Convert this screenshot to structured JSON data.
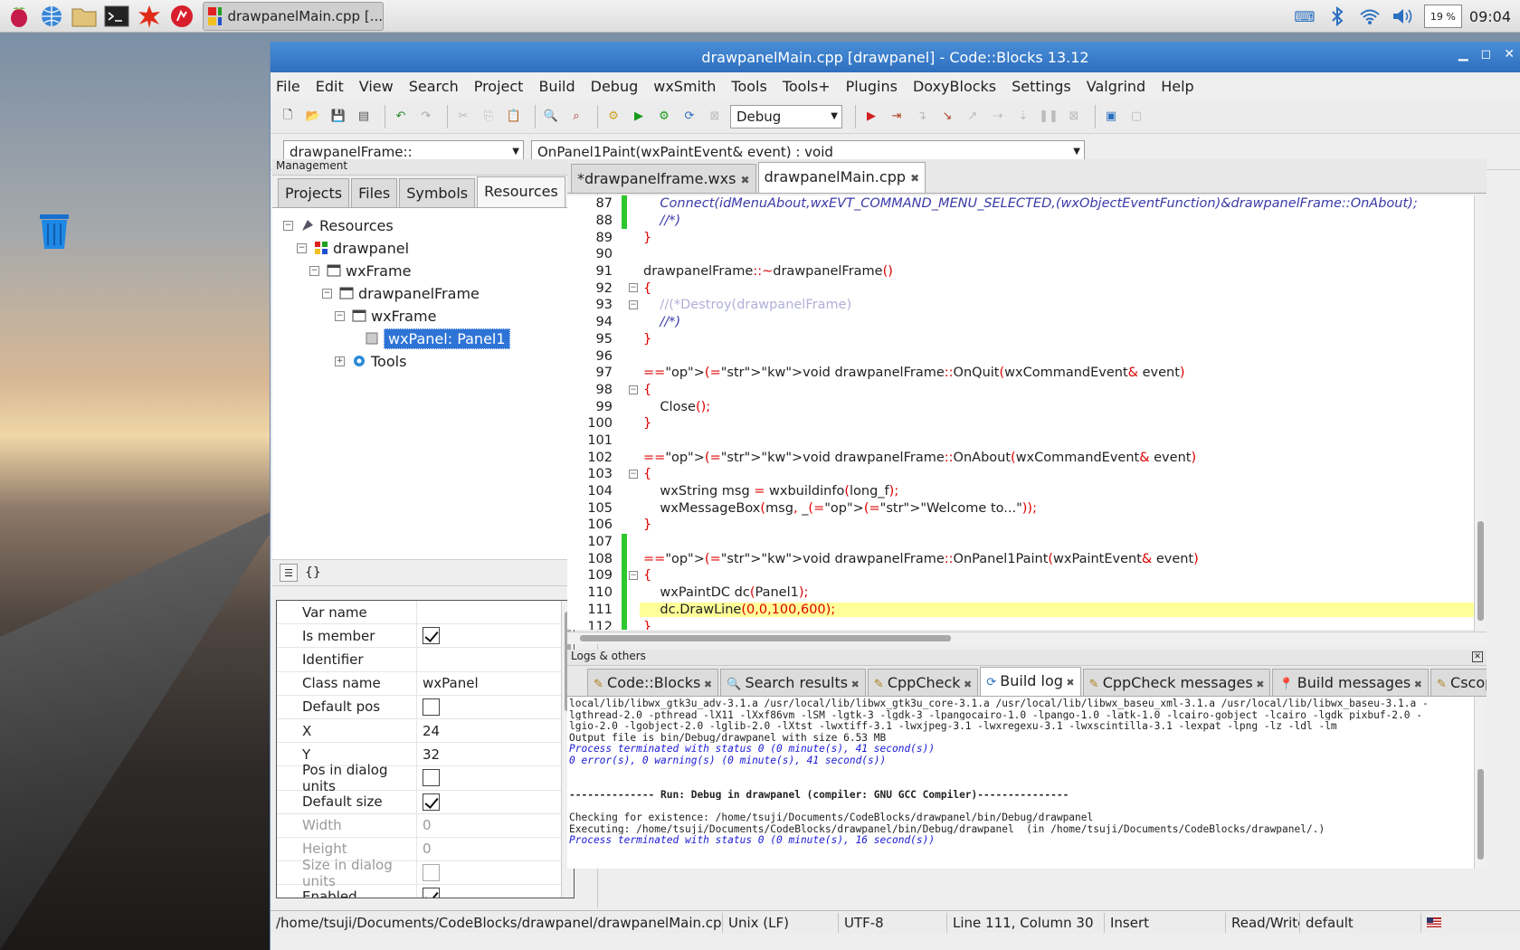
{
  "taskbar": {
    "task_label": "drawpanelMain.cpp [...",
    "cpu": "19 %",
    "clock": "09:04"
  },
  "window": {
    "title": "drawpanelMain.cpp [drawpanel] - Code::Blocks 13.12"
  },
  "menu": [
    "File",
    "Edit",
    "View",
    "Search",
    "Project",
    "Build",
    "Debug",
    "wxSmith",
    "Tools",
    "Tools+",
    "Plugins",
    "DoxyBlocks",
    "Settings",
    "Valgrind",
    "Help"
  ],
  "toolbar": {
    "build_target": "Debug"
  },
  "scope": {
    "class": "drawpanelFrame::",
    "function": "OnPanel1Paint(wxPaintEvent& event) : void"
  },
  "management": {
    "title": "Management",
    "tabs": [
      "Projects",
      "Files",
      "Symbols",
      "Resources"
    ],
    "tree": [
      "Resources",
      "drawpanel",
      "wxFrame",
      "drawpanelFrame",
      "wxFrame",
      "wxPanel: Panel1",
      "Tools"
    ]
  },
  "props_toolbar": {
    "braces": "{}"
  },
  "properties": [
    {
      "name": "Var name",
      "value": ""
    },
    {
      "name": "Is member",
      "check": true
    },
    {
      "name": "Identifier",
      "value": ""
    },
    {
      "name": "Class name",
      "value": "wxPanel"
    },
    {
      "name": "Default pos",
      "check": false
    },
    {
      "name": "X",
      "value": "24"
    },
    {
      "name": "Y",
      "value": "32"
    },
    {
      "name": "Pos in dialog units",
      "check": false
    },
    {
      "name": "Default size",
      "check": true
    },
    {
      "name": "Width",
      "value": "0",
      "disabled": true
    },
    {
      "name": "Height",
      "value": "0",
      "disabled": true
    },
    {
      "name": "Size in dialog units",
      "check": false,
      "disabled": true
    },
    {
      "name": "Enabled",
      "check": true
    }
  ],
  "editor": {
    "tabs": [
      "*drawpanelframe.wxs",
      "drawpanelMain.cpp"
    ],
    "lines": [
      {
        "n": "87",
        "text": "    Connect(idMenuAbout,wxEVT_COMMAND_MENU_SELECTED,(wxObjectEventFunction)&drawpanelFrame::OnAbout);",
        "cls": "cm",
        "mark": true
      },
      {
        "n": "88",
        "text": "    //*)",
        "cls": "cm",
        "mark": true
      },
      {
        "n": "89",
        "text": "}",
        "cls": "op"
      },
      {
        "n": "90",
        "text": ""
      },
      {
        "n": "91",
        "text": "drawpanelFrame::~drawpanelFrame()"
      },
      {
        "n": "92",
        "text": "{",
        "cls": "op",
        "fold": true
      },
      {
        "n": "93",
        "text": "    //(*Destroy(drawpanelFrame)",
        "cls": "cmg",
        "fold": true
      },
      {
        "n": "94",
        "text": "    //*)",
        "cls": "cm"
      },
      {
        "n": "95",
        "text": "}",
        "cls": "op"
      },
      {
        "n": "96",
        "text": ""
      },
      {
        "n": "97",
        "text": "void drawpanelFrame::OnQuit(wxCommandEvent& event)"
      },
      {
        "n": "98",
        "text": "{",
        "cls": "op",
        "fold": true
      },
      {
        "n": "99",
        "text": "    Close();"
      },
      {
        "n": "100",
        "text": "}",
        "cls": "op"
      },
      {
        "n": "101",
        "text": ""
      },
      {
        "n": "102",
        "text": "void drawpanelFrame::OnAbout(wxCommandEvent& event)"
      },
      {
        "n": "103",
        "text": "{",
        "cls": "op",
        "fold": true
      },
      {
        "n": "104",
        "text": "    wxString msg = wxbuildinfo(long_f);"
      },
      {
        "n": "105",
        "text": "    wxMessageBox(msg, _(\"Welcome to...\"));"
      },
      {
        "n": "106",
        "text": "}",
        "cls": "op"
      },
      {
        "n": "107",
        "text": "",
        "mark": true
      },
      {
        "n": "108",
        "text": "void drawpanelFrame::OnPanel1Paint(wxPaintEvent& event)",
        "mark": true
      },
      {
        "n": "109",
        "text": "{",
        "cls": "op",
        "fold": true,
        "mark": true
      },
      {
        "n": "110",
        "text": "    wxPaintDC dc(Panel1);",
        "mark": true
      },
      {
        "n": "111",
        "text": "    dc.DrawLine(0,0,100,600);",
        "mark": true,
        "hl": true
      },
      {
        "n": "112",
        "text": "}",
        "cls": "op",
        "mark": true
      }
    ]
  },
  "logs": {
    "title": "Logs & others",
    "tabs": [
      "Code::Blocks",
      "Search results",
      "CppCheck",
      "Build log",
      "CppCheck messages",
      "Build messages",
      "Cscope"
    ],
    "lines": [
      {
        "t": "local/lib/libwx_gtk3u_adv-3.1.a /usr/local/lib/libwx_gtk3u_core-3.1.a /usr/local/lib/libwx_baseu_xml-3.1.a /usr/local/lib/libwx_baseu-3.1.a -"
      },
      {
        "t": "lgthread-2.0 -pthread -lX11 -lXxf86vm -lSM -lgtk-3 -lgdk-3 -lpangocairo-1.0 -lpango-1.0 -latk-1.0 -lcairo-gobject -lcairo -lgdk_pixbuf-2.0 -"
      },
      {
        "t": "lgio-2.0 -lgobject-2.0 -lglib-2.0 -lXtst -lwxtiff-3.1 -lwxjpeg-3.1 -lwxregexu-3.1 -lwxscintilla-3.1 -lexpat -lpng -lz -ldl -lm"
      },
      {
        "t": "Output file is bin/Debug/drawpanel with size 6.53 MB"
      },
      {
        "t": "Process terminated with status 0 (0 minute(s), 41 second(s))",
        "c": "blue"
      },
      {
        "t": "0 error(s), 0 warning(s) (0 minute(s), 41 second(s))",
        "c": "blue"
      },
      {
        "t": ""
      },
      {
        "t": ""
      },
      {
        "t": "-------------- Run: Debug in drawpanel (compiler: GNU GCC Compiler)---------------",
        "c": "bold"
      },
      {
        "t": ""
      },
      {
        "t": "Checking for existence: /home/tsuji/Documents/CodeBlocks/drawpanel/bin/Debug/drawpanel"
      },
      {
        "t": "Executing: /home/tsuji/Documents/CodeBlocks/drawpanel/bin/Debug/drawpanel  (in /home/tsuji/Documents/CodeBlocks/drawpanel/.)"
      },
      {
        "t": "Process terminated with status 0 (0 minute(s), 16 second(s))",
        "c": "blue"
      }
    ]
  },
  "status": {
    "path": "/home/tsuji/Documents/CodeBlocks/drawpanel/drawpanelMain.cpp",
    "eol": "Unix (LF)",
    "encoding": "UTF-8",
    "position": "Line 111, Column 30",
    "mode": "Insert",
    "access": "Read/Write",
    "lang": "default"
  }
}
